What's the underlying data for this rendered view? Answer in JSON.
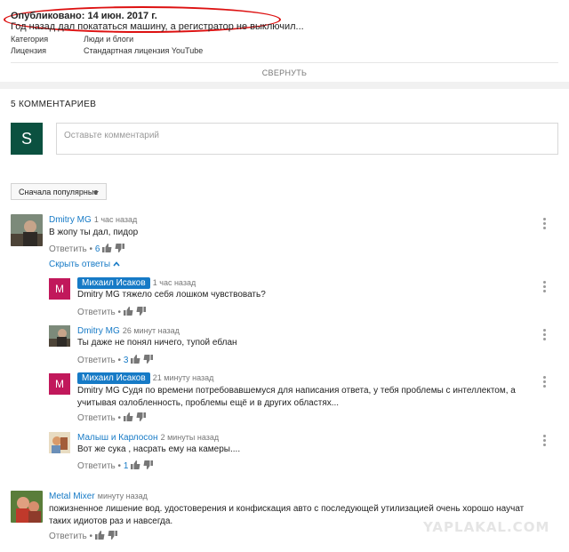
{
  "description": {
    "published": "Опубликовано: 14 июн. 2017 г.",
    "text": "Год назад дал покататься машину, а регистратор не выключил...",
    "category_label": "Категория",
    "category_value": "Люди и блоги",
    "license_label": "Лицензия",
    "license_value": "Стандартная лицензия YouTube",
    "collapse_label": "СВЕРНУТЬ"
  },
  "comments_section": {
    "count_label": "5 КОММЕНТАРИЕВ",
    "user_initial": "S",
    "input_placeholder": "Оставьте комментарий",
    "sort_label": "Сначала популярные"
  },
  "comments": [
    {
      "author": "Dmitry MG",
      "time": "1 час назад",
      "text": "В жопу ты дал, пидор",
      "reply_label": "Ответить",
      "likes": "6",
      "hide_replies_label": "Скрыть ответы",
      "replies": [
        {
          "author": "Михаил Исаков",
          "avatar_initial": "M",
          "time": "1 час назад",
          "text": "Dmitry MG тяжело себя лошком чувствовать?",
          "reply_label": "Ответить",
          "likes": ""
        },
        {
          "author": "Dmitry MG",
          "time": "26 минут назад",
          "text": "Ты даже не понял ничего, тупой еблан",
          "reply_label": "Ответить",
          "likes": "3"
        },
        {
          "author": "Михаил Исаков",
          "avatar_initial": "M",
          "time": "21 минуту назад",
          "text": "Dmitry MG Судя по времени потребовавшемуся для написания ответа, у тебя проблемы с интеллектом, а учитывая озлобленность, проблемы ещё и в других областях...",
          "reply_label": "Ответить",
          "likes": ""
        },
        {
          "author": "Малыш и Карлосон",
          "time": "2 минуты назад",
          "text": "Вот же сука , насрать ему на камеры....",
          "reply_label": "Ответить",
          "likes": "1"
        }
      ]
    },
    {
      "author": "Metal Mixer",
      "time": "минуту назад",
      "text": "пожизненное лишение вод. удостоверения и конфискация авто с последующей утилизацией очень хорошо научат таких идиотов раз и навсегда.",
      "reply_label": "Ответить",
      "likes": ""
    }
  ],
  "watermark": "YAPLAKAL.COM",
  "colors": {
    "accent": "#167ac6",
    "highlight": "#d11111",
    "avatar_s": "#0b5140",
    "avatar_m": "#c1185b"
  }
}
